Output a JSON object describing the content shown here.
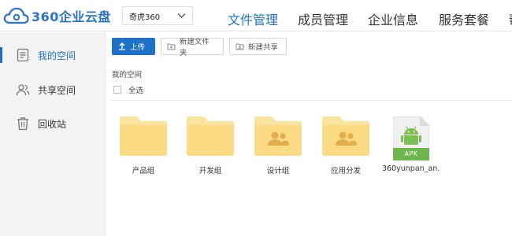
{
  "app": {
    "logo_text": "360企业云盘",
    "brand_color": "#1e72c6"
  },
  "header": {
    "team_select": {
      "value": "奇虎360"
    },
    "nav": [
      {
        "label": "文件管理",
        "active": true
      },
      {
        "label": "成员管理",
        "active": false
      },
      {
        "label": "企业信息",
        "active": false
      },
      {
        "label": "服务套餐",
        "active": false
      },
      {
        "label": "帮",
        "active": false
      }
    ]
  },
  "sidebar": {
    "items": [
      {
        "label": "我的空间",
        "icon": "document-list-icon",
        "active": true
      },
      {
        "label": "共享空间",
        "icon": "users-icon",
        "active": false
      },
      {
        "label": "回收站",
        "icon": "trash-icon",
        "active": false
      }
    ]
  },
  "toolbar": {
    "upload_label": "上传",
    "new_folder_label": "新建文件夹",
    "new_share_label": "新建共享"
  },
  "main": {
    "breadcrumb": "我的空间",
    "select_all_label": "全选",
    "files": [
      {
        "name": "产品组",
        "type": "folder"
      },
      {
        "name": "开发组",
        "type": "folder"
      },
      {
        "name": "设计组",
        "type": "shared-folder"
      },
      {
        "name": "应用分发",
        "type": "shared-folder"
      },
      {
        "name": "360yunpan_an...",
        "type": "apk",
        "badge": "APK"
      }
    ]
  }
}
